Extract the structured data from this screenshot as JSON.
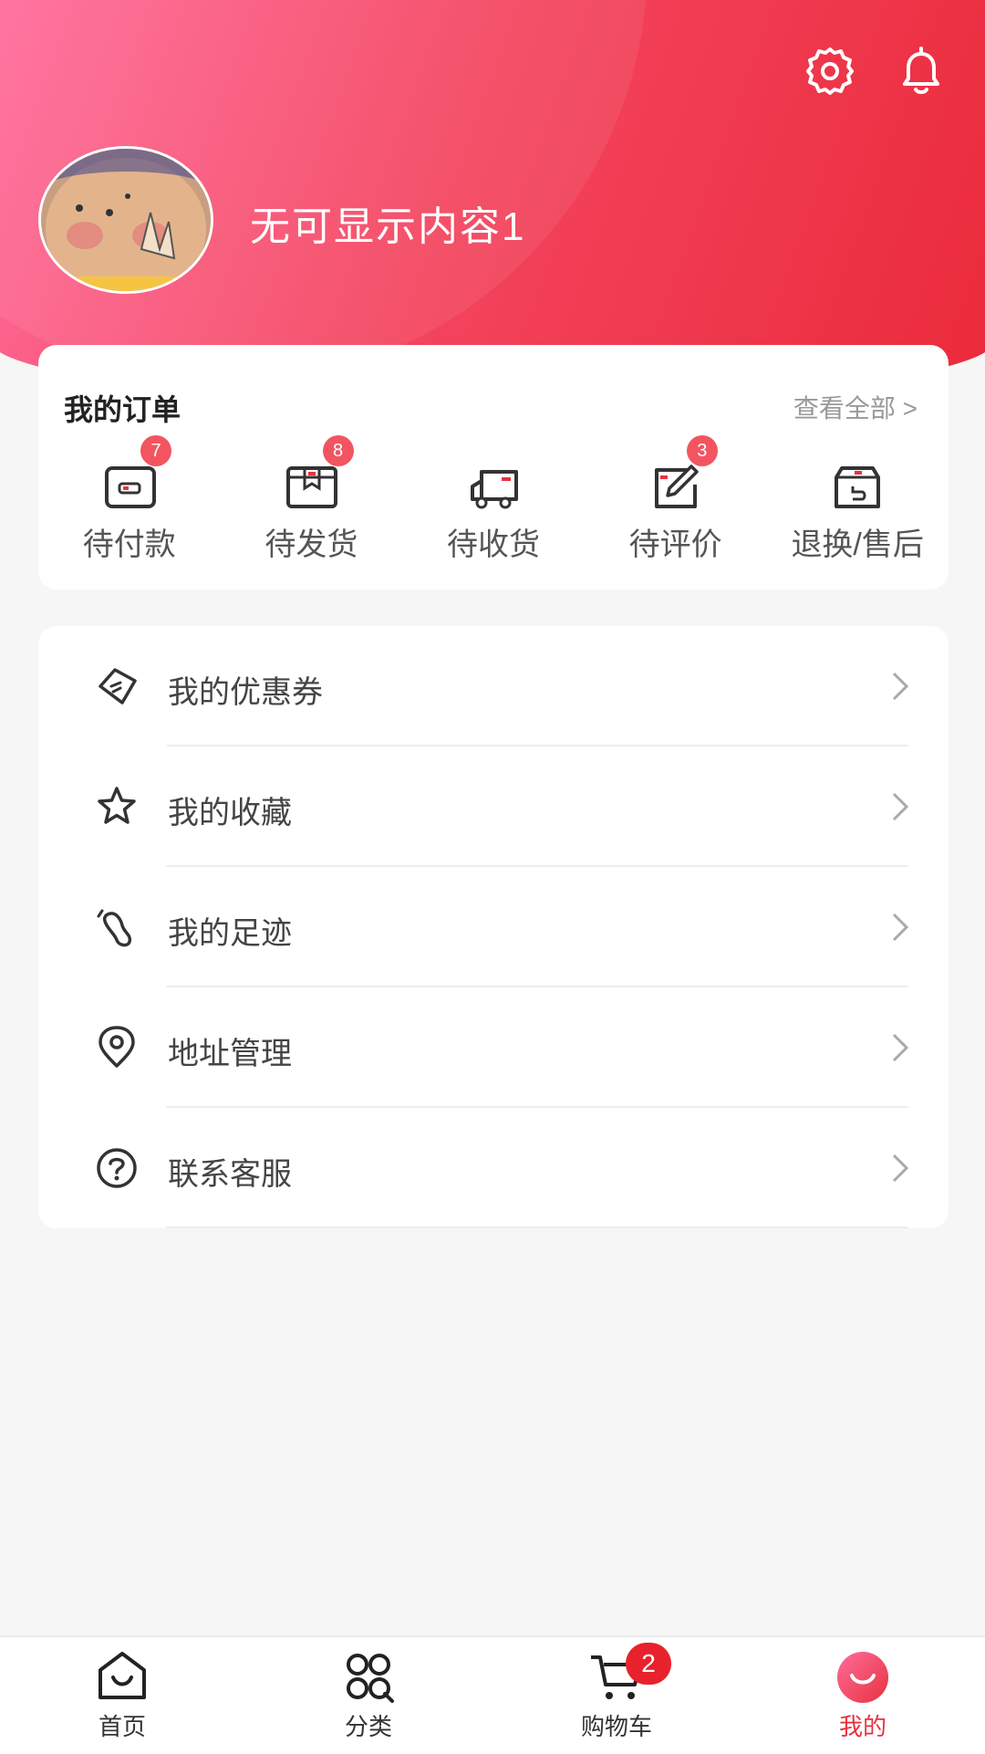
{
  "header": {
    "settings_icon": "gear-icon",
    "notification_icon": "bell-icon",
    "username": "无可显示内容1"
  },
  "orders": {
    "title": "我的订单",
    "view_all": "查看全部 >",
    "items": [
      {
        "label": "待付款",
        "icon": "wallet-icon",
        "badge": "7"
      },
      {
        "label": "待发货",
        "icon": "package-icon",
        "badge": "8"
      },
      {
        "label": "待收货",
        "icon": "truck-icon",
        "badge": ""
      },
      {
        "label": "待评价",
        "icon": "edit-icon",
        "badge": "3"
      },
      {
        "label": "退换/售后",
        "icon": "return-icon",
        "badge": ""
      }
    ]
  },
  "menu": {
    "items": [
      {
        "label": "我的优惠券",
        "icon": "coupon-icon"
      },
      {
        "label": "我的收藏",
        "icon": "star-icon"
      },
      {
        "label": "我的足迹",
        "icon": "footprint-icon"
      },
      {
        "label": "地址管理",
        "icon": "location-icon"
      },
      {
        "label": "联系客服",
        "icon": "help-icon"
      }
    ]
  },
  "tabbar": {
    "items": [
      {
        "label": "首页",
        "icon": "home-icon"
      },
      {
        "label": "分类",
        "icon": "category-icon"
      },
      {
        "label": "购物车",
        "icon": "cart-icon",
        "badge": "2"
      },
      {
        "label": "我的",
        "icon": "profile-icon",
        "active": true
      }
    ]
  },
  "colors": {
    "accent": "#e8323f",
    "badge": "#f25560",
    "header_gradient_start": "#ff6c9b",
    "header_gradient_end": "#ea2a3a"
  }
}
